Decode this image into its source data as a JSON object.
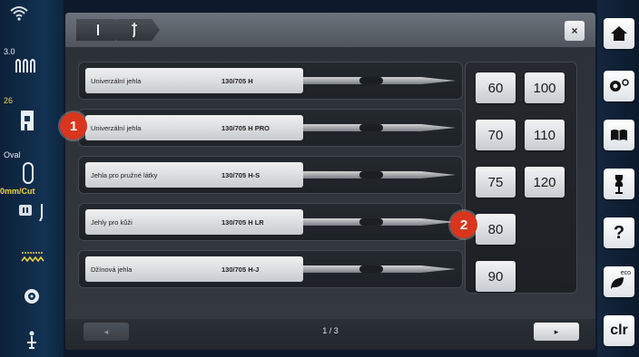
{
  "left_bar": {
    "stitch_width_value": "3.0",
    "stitch_length_value": "26",
    "presser_foot_label": "Oval",
    "needle_stop_label": "0mm/Cut"
  },
  "header": {
    "close_icon": "×"
  },
  "needles": [
    {
      "name": "Univerzální jehla",
      "code": "130/705 H"
    },
    {
      "name": "Univerzální jehla",
      "code": "130/705 H PRO"
    },
    {
      "name": "Jehla pro pružné látky",
      "code": "130/705 H-S"
    },
    {
      "name": "Jehly pro kůži",
      "code": "130/705 H LR"
    },
    {
      "name": "Džínová jehla",
      "code": "130/705 H-J"
    }
  ],
  "sizes": [
    "60",
    "100",
    "70",
    "110",
    "75",
    "120",
    "80",
    "90"
  ],
  "footer": {
    "page_indicator": "1 / 3",
    "prev_icon": "◂",
    "next_icon": "▸"
  },
  "right_bar": {
    "help_label": "?",
    "eco_label": "eco",
    "clr_label": "clr"
  },
  "callouts": [
    "1",
    "2"
  ],
  "colors": {
    "callout": "#d9361e",
    "accent_yellow": "#f2d53c"
  }
}
